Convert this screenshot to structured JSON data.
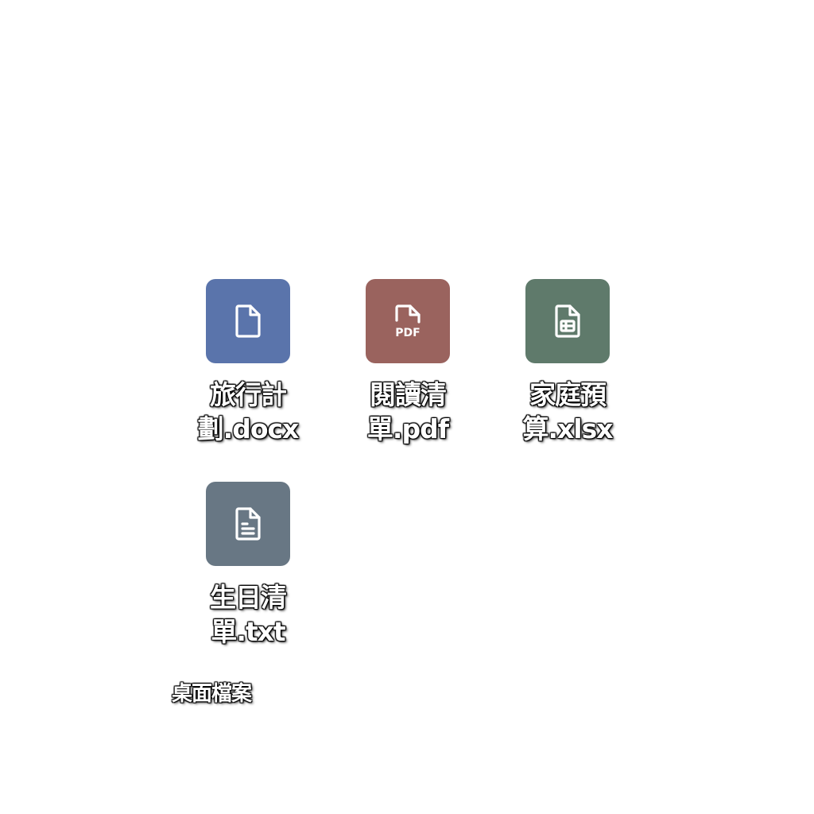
{
  "desktop": {
    "caption": "桌面檔案",
    "files": [
      {
        "name_line1": "旅行計",
        "name_line2": "劃.docx",
        "type": "docx",
        "icon": "document-icon",
        "color": "#5a74ab"
      },
      {
        "name_line1": "閱讀清",
        "name_line2": "單.pdf",
        "type": "pdf",
        "icon": "pdf-icon",
        "color": "#9a635e",
        "badge": "PDF"
      },
      {
        "name_line1": "家庭預",
        "name_line2": "算.xlsx",
        "type": "xlsx",
        "icon": "spreadsheet-icon",
        "color": "#5f7a6b"
      },
      {
        "name_line1": "生日清",
        "name_line2": "單.txt",
        "type": "txt",
        "icon": "text-file-icon",
        "color": "#687784"
      }
    ]
  }
}
